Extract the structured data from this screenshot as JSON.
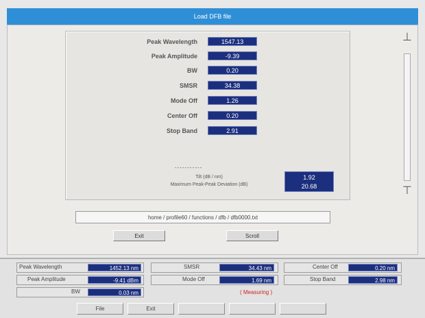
{
  "window": {
    "title": "Load DFB file"
  },
  "measurements": [
    {
      "label": "Peak Wavelength",
      "value": "1547.13"
    },
    {
      "label": "Peak Amplitude",
      "value": "-9.39"
    },
    {
      "label": "BW",
      "value": "0.20"
    },
    {
      "label": "SMSR",
      "value": "34.38"
    },
    {
      "label": "Mode Off",
      "value": "1.26"
    },
    {
      "label": "Center Off",
      "value": "0.20"
    },
    {
      "label": "Stop Band",
      "value": "2.91"
    }
  ],
  "tilt": {
    "dashes": "-----------",
    "label1": "Tilt (dB / nm)",
    "label2": "Maximum Peak-Peak Deviation (dB)",
    "value1": "1.92",
    "value2": "20.68"
  },
  "scroll": {
    "up_glyph": "⊥",
    "down_glyph": "⊤"
  },
  "path": "home / profile60 / functions / dfb / dfb0000.txt",
  "buttons": {
    "exit": "Exit",
    "scroll": "Scroll"
  },
  "status": {
    "peak_wavelength_label": "Peak Wavelength",
    "peak_wavelength_value": "1452.13 nm",
    "peak_amplitude_label": "Peak Amplitude",
    "peak_amplitude_value": "-9.41 dBm",
    "bw_label": "BW",
    "bw_value": "0.03 nm",
    "smsr_label": "SMSR",
    "smsr_value": "34.43 nm",
    "mode_off_label": "Mode Off",
    "mode_off_value": "1.69 nm",
    "measuring": "( Measuring )",
    "center_off_label": "Center Off",
    "center_off_value": "0.20 nm",
    "stop_band_label": "Stop Band",
    "stop_band_value": "2.98 nm"
  },
  "function_keys": {
    "f1": "File",
    "f2": "Exit",
    "f3": "",
    "f4": "",
    "f5": ""
  }
}
